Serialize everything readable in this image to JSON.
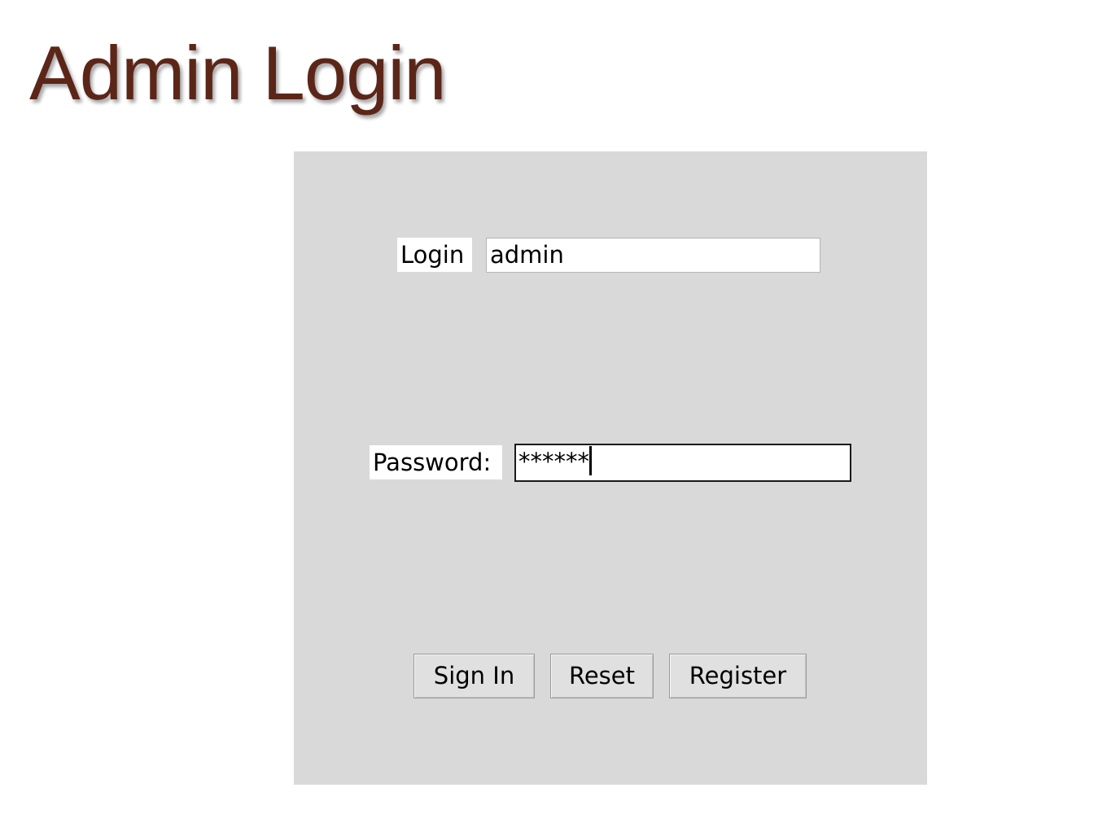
{
  "page": {
    "title": "Admin Login"
  },
  "form": {
    "login_label": "Login",
    "login_value": "admin",
    "password_label": "Password:",
    "password_value": "******"
  },
  "buttons": {
    "sign_in": "Sign In",
    "reset": "Reset",
    "register": "Register"
  },
  "colors": {
    "title": "#5b2618",
    "panel_background": "#d9d9d9",
    "field_background": "#ffffff"
  }
}
